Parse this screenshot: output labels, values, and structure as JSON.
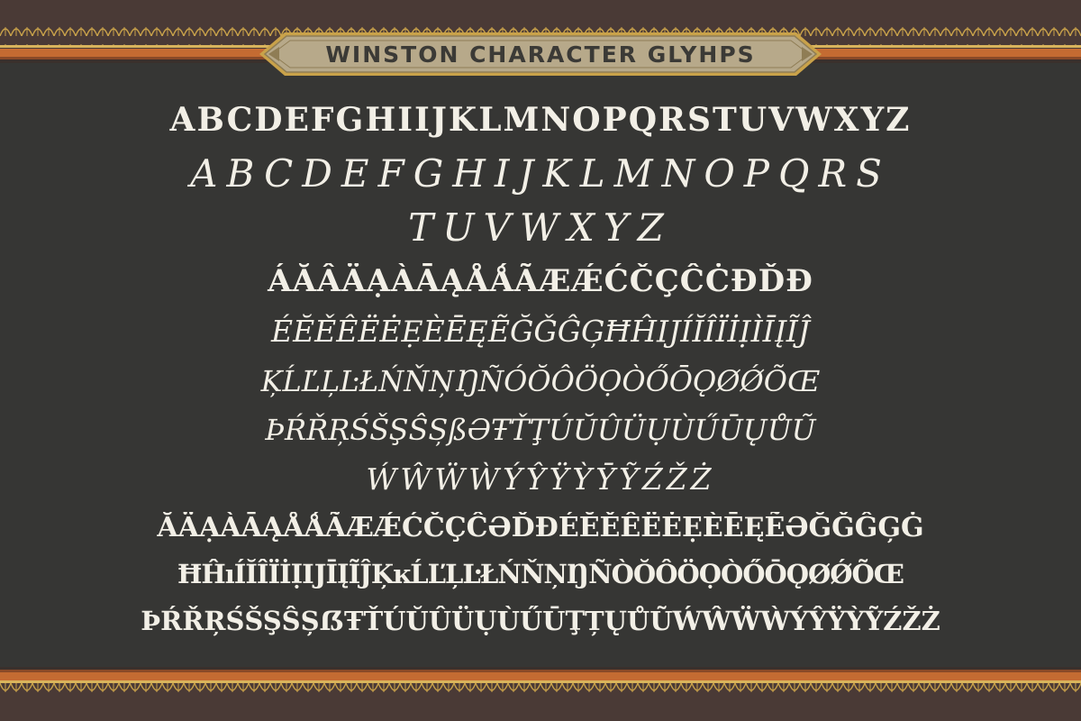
{
  "banner": {
    "title": "WINSTON CHARACTER GLYHPS"
  },
  "glyphs": {
    "uppercase": "ABCDEFGHIIJKLMNOPQRSTUVWXYZ",
    "alternates_line1": "ABCDEFGHIJKLMNOPQRS",
    "alternates_line2": "TUVWXYZ",
    "accented_line1": "ÁĂÂÄẠÀĀĄÅǺÃÆǼĆČÇĈĊĐĎĐ",
    "accented_line2": "ÉĔĚÊËĖẸÈĒĘẼĞǦĜĢĦĤĲÍĬÎÏİỊÌĪĮĨĴ",
    "accented_line3": "ĶĹĽĻĿŁŃŇŅŊÑÓŎÔÖỌÒŐŌǪØǾÕŒ",
    "accented_line4": "ÞŔŘŖŚŠŞŜȘßƏŦŤŢÚŬÛÜỤÙŰŪŲŮŨ",
    "accented_line5": "ẂŴẄẀÝŶŸỲȲỸŹŽŻ",
    "accented_line6": "ĂÄẠÀĀĄÅǺÃÆǼĆČÇĈƏĎĐÉĔĚÊËĖẸÈĒĘẼƏĞǦĜĢĠ",
    "accented_line7": "ĦĤıÍĬÎÏİỊĲĪĮĨĴĶĸĹĽĻĿŁŃŇŅŊÑÒŎÔÖỌÒŐŌǪØǾÕŒ",
    "accented_line8": "ÞŔŘŖŚŠŞŜȘẞŦŤÚŬÛÜỤÙŰŪŢȚŲŮŨẂŴẄẀÝŶŸỲỸŹŽŻ"
  },
  "colors": {
    "panel": "#363634",
    "glyph_text": "#f2efe6",
    "border_dark": "#4a3a36",
    "border_orange": "#c46b32",
    "border_gold": "#c9a24a",
    "banner_fill": "#b7a98a",
    "banner_text": "#3b3a36"
  }
}
